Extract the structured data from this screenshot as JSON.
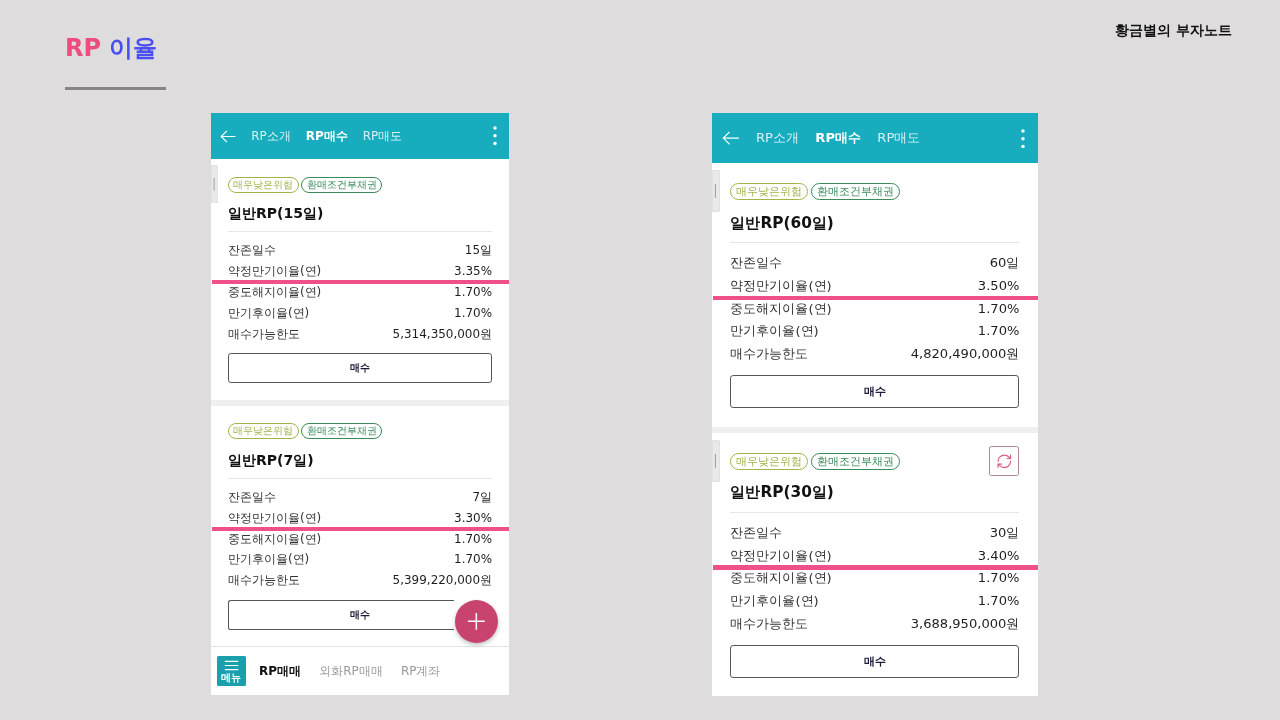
{
  "header": {
    "title_parts": [
      {
        "text": "RP",
        "color": "#ef4b7d"
      },
      {
        "text": "이율",
        "color": "#4b4ef0"
      }
    ],
    "brand": "황금별의 부자노트"
  },
  "phones": [
    {
      "tabs": [
        {
          "label": "RP소개",
          "selected": false
        },
        {
          "label": "RP매수",
          "selected": true
        },
        {
          "label": "RP매도",
          "selected": false
        }
      ],
      "cards": [
        {
          "side_handle": true,
          "tags": [
            {
              "label": "매우낮은위험",
              "color": "#9fb54a"
            },
            {
              "label": "환매조건부채권",
              "color": "#3a8a5a"
            }
          ],
          "title": "일반RP(15일)",
          "rows": [
            {
              "label": "잔존일수",
              "value": "15일",
              "highlighted": false
            },
            {
              "label": "약정만기이율(연)",
              "value": "3.35%",
              "highlighted": true
            },
            {
              "label": "중도해지이율(연)",
              "value": "1.70%",
              "highlighted": false
            },
            {
              "label": "만기후이율(연)",
              "value": "1.70%",
              "highlighted": false
            },
            {
              "label": "매수가능한도",
              "value": "5,314,350,000원",
              "highlighted": false
            }
          ],
          "button": "매수"
        },
        {
          "tags": [
            {
              "label": "매우낮은위험",
              "color": "#9fb54a"
            },
            {
              "label": "환매조건부채권",
              "color": "#3a8a5a"
            }
          ],
          "title": "일반RP(7일)",
          "rows": [
            {
              "label": "잔존일수",
              "value": "7일",
              "highlighted": false
            },
            {
              "label": "약정만기이율(연)",
              "value": "3.30%",
              "highlighted": true
            },
            {
              "label": "중도해지이율(연)",
              "value": "1.70%",
              "highlighted": false
            },
            {
              "label": "만기후이율(연)",
              "value": "1.70%",
              "highlighted": false
            },
            {
              "label": "매수가능한도",
              "value": "5,399,220,000원",
              "highlighted": false
            }
          ],
          "button": "매수"
        }
      ],
      "add_button": true,
      "bottom_nav": {
        "menu_label": "메뉴",
        "items": [
          {
            "label": "RP매매",
            "selected": true
          },
          {
            "label": "외화RP매매",
            "selected": false
          },
          {
            "label": "RP계좌",
            "selected": false
          }
        ]
      }
    },
    {
      "tabs": [
        {
          "label": "RP소개",
          "selected": false
        },
        {
          "label": "RP매수",
          "selected": true
        },
        {
          "label": "RP매도",
          "selected": false
        }
      ],
      "cards": [
        {
          "side_handle": true,
          "tags": [
            {
              "label": "매우낮은위험",
              "color": "#9fb54a"
            },
            {
              "label": "환매조건부채권",
              "color": "#3a8a5a"
            }
          ],
          "title": "일반RP(60일)",
          "rows": [
            {
              "label": "잔존일수",
              "value": "60일",
              "highlighted": false
            },
            {
              "label": "약정만기이율(연)",
              "value": "3.50%",
              "highlighted": true
            },
            {
              "label": "중도해지이율(연)",
              "value": "1.70%",
              "highlighted": false
            },
            {
              "label": "만기후이율(연)",
              "value": "1.70%",
              "highlighted": false
            },
            {
              "label": "매수가능한도",
              "value": "4,820,490,000원",
              "highlighted": false
            }
          ],
          "button": "매수"
        },
        {
          "side_handle": true,
          "refresh_button": true,
          "tags": [
            {
              "label": "매우낮은위험",
              "color": "#9fb54a"
            },
            {
              "label": "환매조건부채권",
              "color": "#3a8a5a"
            }
          ],
          "title": "일반RP(30일)",
          "rows": [
            {
              "label": "잔존일수",
              "value": "30일",
              "highlighted": false
            },
            {
              "label": "약정만기이율(연)",
              "value": "3.40%",
              "highlighted": true
            },
            {
              "label": "중도해지이율(연)",
              "value": "1.70%",
              "highlighted": false
            },
            {
              "label": "만기후이율(연)",
              "value": "1.70%",
              "highlighted": false
            },
            {
              "label": "매수가능한도",
              "value": "3,688,950,000원",
              "highlighted": false
            }
          ],
          "button": "매수"
        }
      ]
    }
  ]
}
